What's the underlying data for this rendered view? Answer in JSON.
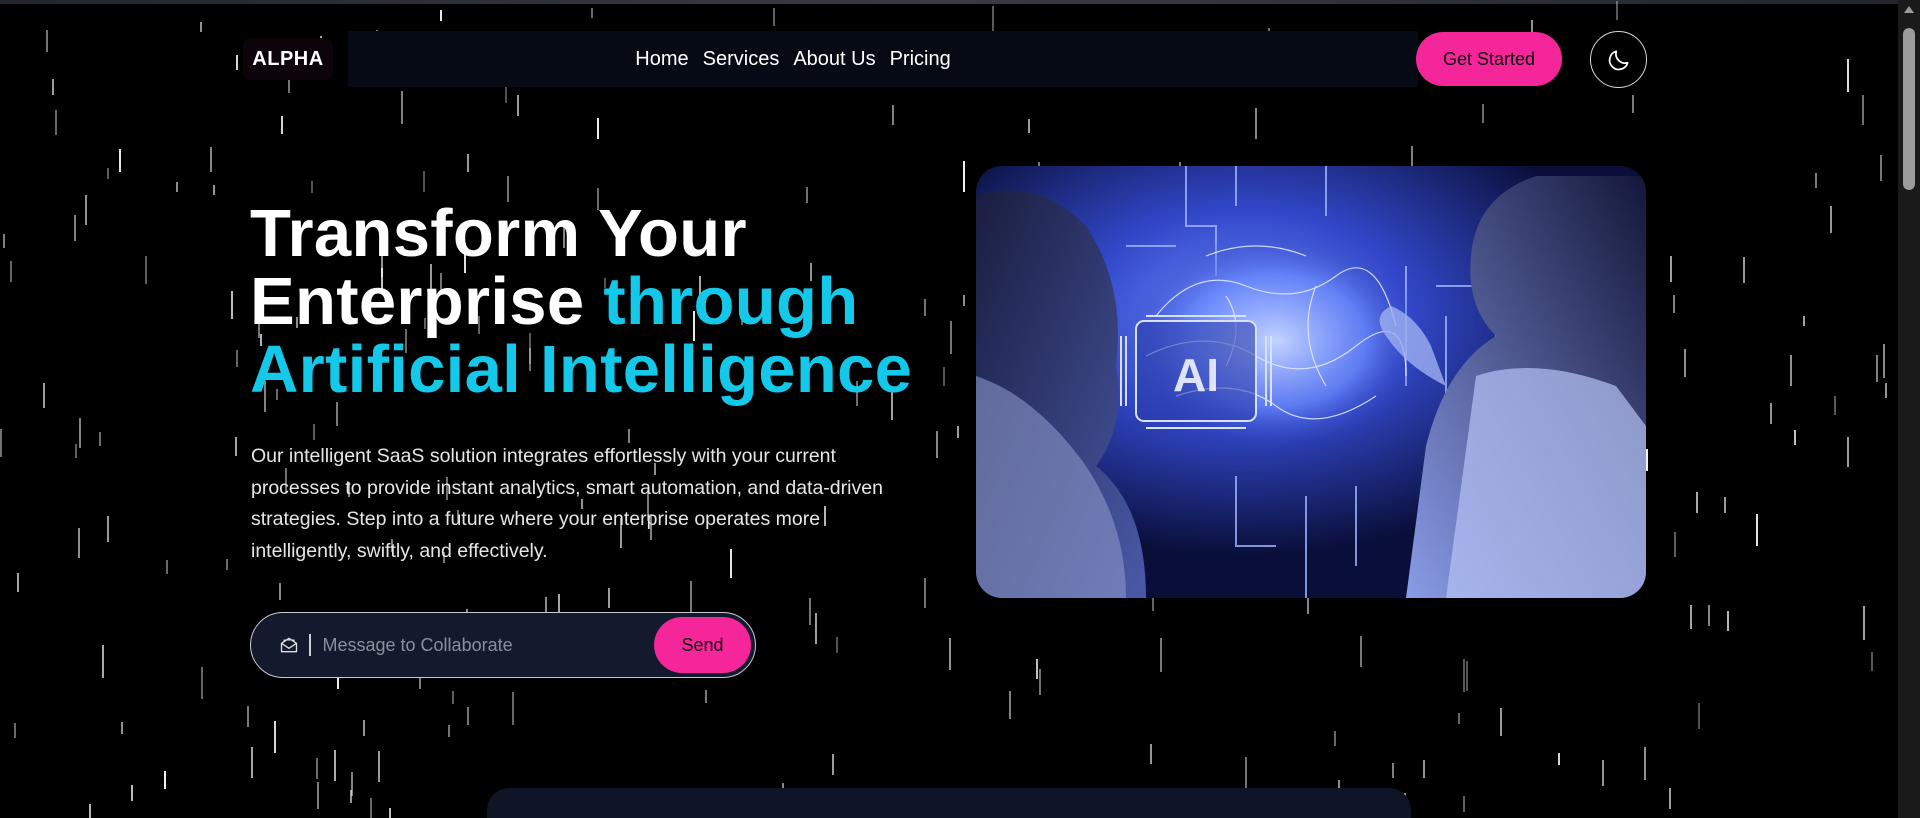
{
  "brand": {
    "logo_text": "ALPHA"
  },
  "nav": {
    "items": [
      {
        "label": "Home"
      },
      {
        "label": "Services"
      },
      {
        "label": "About Us"
      },
      {
        "label": "Pricing"
      }
    ],
    "cta_label": "Get Started",
    "theme_toggle_icon": "moon-icon"
  },
  "hero": {
    "title_line1": "Transform Your",
    "title_line2_plain": "Enterprise",
    "title_line2_accent": "through",
    "title_line3_accent": "Artificial Intelligence",
    "description": "Our intelligent SaaS solution integrates effortlessly with your current processes to provide instant analytics, smart automation, and data-driven strategies. Step into a future where your enterprise operates more intelligently, swiftly, and effectively.",
    "collab_input": {
      "placeholder": "Message to Collaborate",
      "value": ""
    },
    "send_label": "Send",
    "image_label": "AI"
  },
  "colors": {
    "background": "#000000",
    "accent_cyan": "#14c8ea",
    "accent_pink": "#f5259a",
    "nav_bg": "#060a14",
    "input_bg": "#141a2e"
  }
}
